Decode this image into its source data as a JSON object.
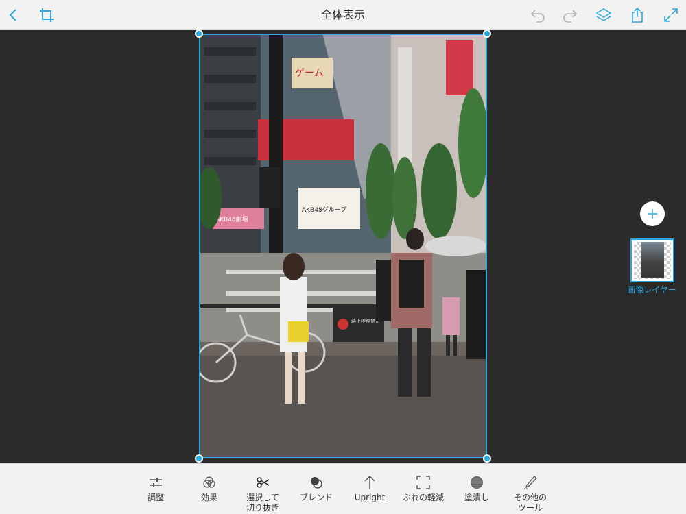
{
  "header": {
    "title": "全体表示",
    "icons": [
      "back-chevron-icon",
      "crop-icon",
      "undo-icon",
      "redo-icon",
      "layers-icon",
      "share-icon",
      "fullscreen-icon"
    ]
  },
  "layers": {
    "add_icon": "plus-icon",
    "items": [
      {
        "label": "画像レイヤー",
        "selected": true
      }
    ]
  },
  "photo": {
    "signs": {
      "building_sign": "ゲーム",
      "akb_sign": "AKB48劇場",
      "group_store": "AKB48グループ",
      "no_smoking": "路上喫煙禁止"
    }
  },
  "toolbar": {
    "tools": [
      {
        "label": "調整",
        "icon": "sliders-icon"
      },
      {
        "label": "効果",
        "icon": "effects-icon"
      },
      {
        "label": "選択して\n切り抜き",
        "icon": "scissors-icon"
      },
      {
        "label": "ブレンド",
        "icon": "blend-icon"
      },
      {
        "label": "Upright",
        "icon": "upright-arrow-icon"
      },
      {
        "label": "ぶれの軽減",
        "icon": "shake-reduction-icon"
      },
      {
        "label": "塗潰し",
        "icon": "fill-icon"
      },
      {
        "label": "その他の\nツール",
        "icon": "pencil-icon"
      }
    ]
  },
  "colors": {
    "accent": "#2aa7e0",
    "bar_bg": "#f2f2f2",
    "canvas_bg": "#2b2b2b"
  }
}
